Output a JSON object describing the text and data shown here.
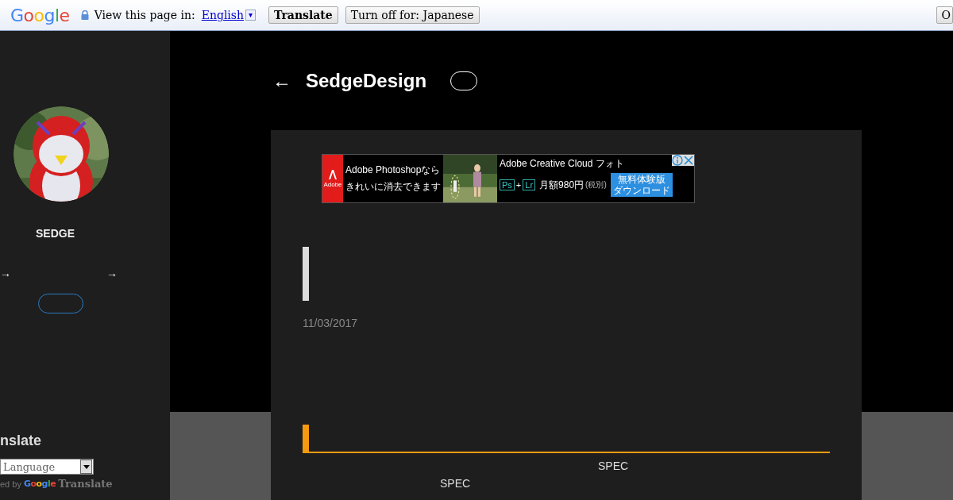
{
  "translate_bar": {
    "logo": "Google",
    "prompt": "View this page in:",
    "language": "English",
    "dropdown_glyph": "▾",
    "buttons": [
      {
        "label": "Translate",
        "kind": "primary"
      },
      {
        "label": "Turn off for: Japanese",
        "kind": "normal"
      },
      {
        "label": "O",
        "kind": "normal"
      }
    ]
  },
  "sidebar": {
    "name": "SEDGE",
    "arrows": [
      "→",
      "→"
    ],
    "translate_heading": "nslate",
    "language_select": "Language",
    "powered_by": "ed by",
    "powered_logo": "Google",
    "powered_product": "Translate"
  },
  "header": {
    "back": "←",
    "title": "SedgeDesign"
  },
  "ad": {
    "brand": "Adobe",
    "headline": [
      "Adobe Photoshopなら",
      "きれいに消去できます"
    ],
    "title": "Adobe Creative Cloud フォト",
    "apps": [
      "Ps",
      "Lr"
    ],
    "plus": "+",
    "price": "月額980円",
    "price_note": "(税別)",
    "cta": [
      "無料体験版",
      "ダウンロード"
    ]
  },
  "post": {
    "date": "11/03/2017",
    "spec_labels": [
      "SPEC",
      "SPEC"
    ]
  }
}
